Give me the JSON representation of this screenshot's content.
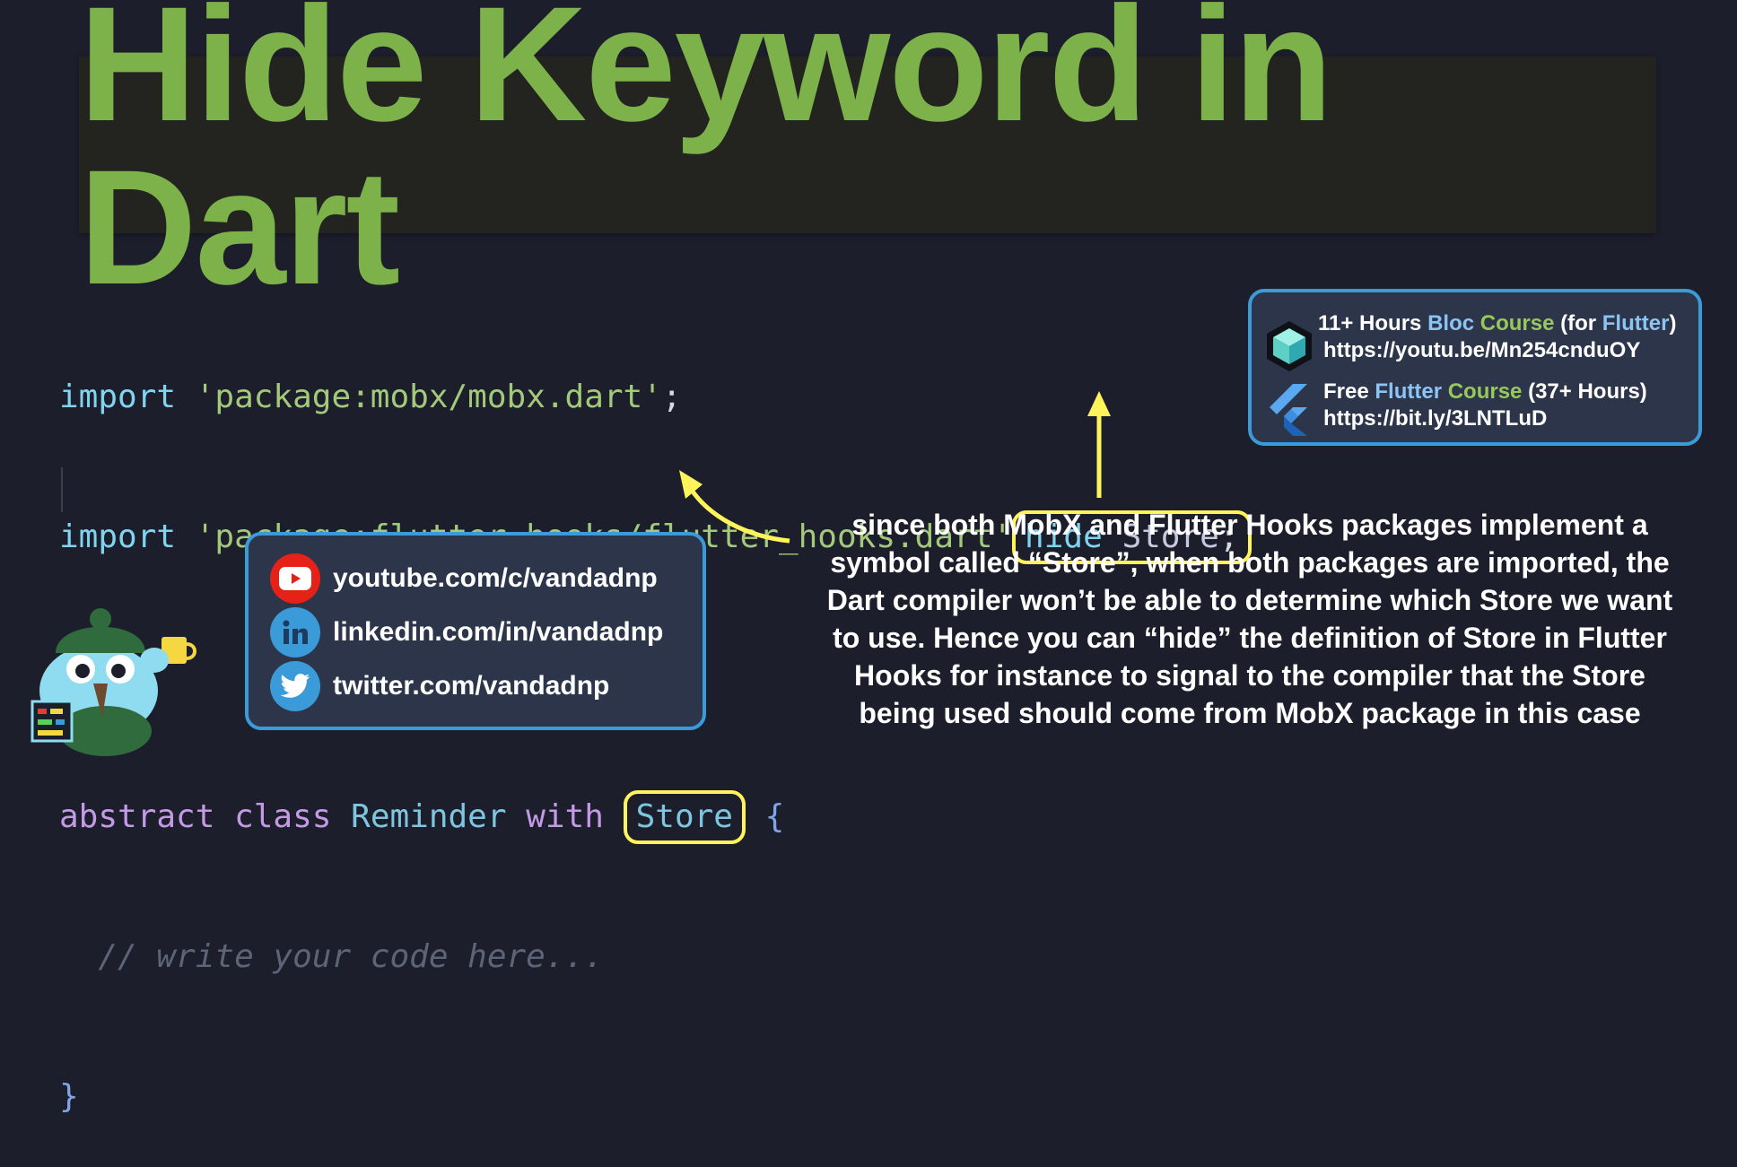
{
  "title": "Hide Keyword in Dart",
  "code": {
    "line1": {
      "kw": "import",
      "str": "'package:mobx/mobx.dart'",
      "end": ";"
    },
    "line2": {
      "kw": "import",
      "str": "'package:flutter_hooks/flutter_hooks.dart'",
      "hide_kw": "hide",
      "hide_type": "Store",
      "end": ";"
    },
    "line4": {
      "kw1": "abstract",
      "kw2": "class",
      "name": "Reminder",
      "kw3": "with",
      "type": "Store",
      "brace": "{"
    },
    "line5": {
      "comment": "// write your code here..."
    },
    "line6": {
      "brace": "}"
    }
  },
  "course_card": {
    "row1": {
      "prefix": "11+ Hours ",
      "highlight1": "Bloc",
      "mid": " ",
      "highlight2": "Course",
      "after": " (for ",
      "highlight3": "Flutter",
      "suffix": ")",
      "url": "https://youtu.be/Mn254cnduOY"
    },
    "row2": {
      "prefix": "Free ",
      "highlight1": "Flutter",
      "mid": " ",
      "highlight2": "Course",
      "suffix": " (37+ Hours)",
      "url": "https://bit.ly/3LNTLuD"
    }
  },
  "social": {
    "youtube": "youtube.com/c/vandadnp",
    "linkedin": "linkedin.com/in/vandadnp",
    "twitter": "twitter.com/vandadnp"
  },
  "explanation": [
    "since both MobX and Flutter Hooks packages implement a",
    "symbol called “Store”, when both packages are imported, the",
    "Dart compiler won’t be able to determine which Store we want",
    "to use. Hence you can “hide” the definition of Store in Flutter",
    "Hooks for instance to signal to the compiler that the Store",
    "being used should come from MobX  package in this case"
  ],
  "colors": {
    "background": "#1d1e2c",
    "title_green": "#7db14a",
    "highlight_yellow": "#fff45a",
    "card_border": "#3b9ad8",
    "youtube_red": "#e62117",
    "social_blue": "#3b9ad8"
  },
  "icons": [
    "cube-icon",
    "flutter-icon",
    "youtube-icon",
    "linkedin-icon",
    "twitter-icon",
    "mascot-image",
    "arrow-icon"
  ]
}
